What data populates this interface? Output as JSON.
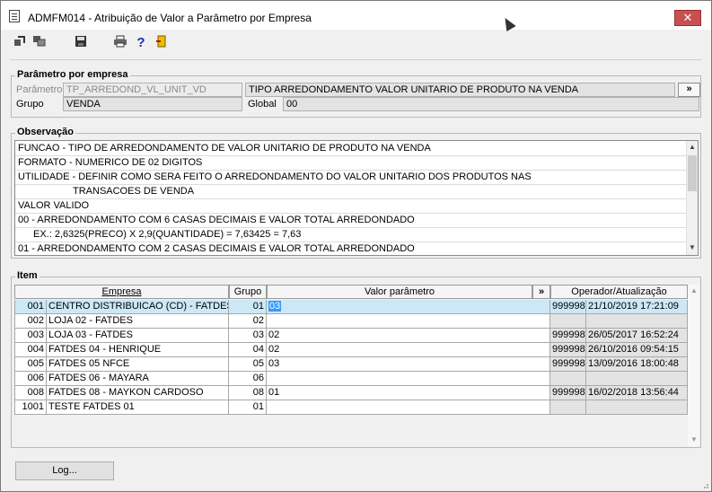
{
  "window": {
    "title": "ADMFM014 - Atribuição de Valor a Parâmetro por Empresa",
    "close_glyph": "✕"
  },
  "toolbar": {
    "icons": [
      "arrow-out-icon",
      "copy-icon",
      "save-icon",
      "print-icon",
      "help-icon",
      "exit-door-icon"
    ],
    "help_glyph": "?"
  },
  "parametro": {
    "section_title": "Parâmetro por empresa",
    "parametro_label": "Parâmetro",
    "parametro_value": "TP_ARREDOND_VL_UNIT_VD",
    "descricao_value": "TIPO ARREDONDAMENTO VALOR UNITARIO DE PRODUTO NA VENDA",
    "more_button": "»",
    "grupo_label": "Grupo",
    "grupo_value": "VENDA",
    "global_label": "Global",
    "global_value": "00"
  },
  "observacao": {
    "section_title": "Observação",
    "lines": [
      "FUNCAO - TIPO DE ARREDONDAMENTO DE VALOR UNITARIO DE PRODUTO NA VENDA",
      "FORMATO - NUMERICO DE 02 DIGITOS",
      "UTILIDADE - DEFINIR COMO SERA FEITO O ARREDONDAMENTO DO VALOR UNITARIO DOS PRODUTOS NAS",
      "TRANSACOES DE VENDA",
      "VALOR VALIDO",
      "00 - ARREDONDAMENTO COM 6 CASAS DECIMAIS E VALOR TOTAL ARREDONDADO",
      "EX.:   2,6325(PRECO) X 2,9(QUANTIDADE) = 7,63425 = 7,63",
      "01 - ARREDONDAMENTO COM 2 CASAS DECIMAIS E VALOR TOTAL ARREDONDADO"
    ]
  },
  "item": {
    "section_title": "Item",
    "columns": {
      "empresa": "Empresa",
      "grupo": "Grupo",
      "valor": "Valor parâmetro",
      "more": "»",
      "operador": "Operador/Atualização"
    },
    "rows": [
      {
        "cod": "001",
        "empresa": "CENTRO DISTRIBUICAO (CD) - FATDES",
        "grupo": "01",
        "valor": "03",
        "operador": "999998",
        "data": "21/10/2019 17:21:09"
      },
      {
        "cod": "002",
        "empresa": "LOJA 02 - FATDES",
        "grupo": "02",
        "valor": "",
        "operador": "",
        "data": ""
      },
      {
        "cod": "003",
        "empresa": "LOJA 03 - FATDES",
        "grupo": "03",
        "valor": "02",
        "operador": "999998",
        "data": "26/05/2017 16:52:24"
      },
      {
        "cod": "004",
        "empresa": "FATDES 04 - HENRIQUE",
        "grupo": "04",
        "valor": "02",
        "operador": "999998",
        "data": "26/10/2016 09:54:15"
      },
      {
        "cod": "005",
        "empresa": "FATDES 05 NFCE",
        "grupo": "05",
        "valor": "03",
        "operador": "999998",
        "data": "13/09/2016 18:00:48"
      },
      {
        "cod": "006",
        "empresa": "FATDES 06 - MAYARA",
        "grupo": "06",
        "valor": "",
        "operador": "",
        "data": ""
      },
      {
        "cod": "008",
        "empresa": "FATDES 08 - MAYKON CARDOSO",
        "grupo": "08",
        "valor": "01",
        "operador": "999998",
        "data": "16/02/2018 13:56:44"
      },
      {
        "cod": "1001",
        "empresa": "TESTE FATDES 01",
        "grupo": "01",
        "valor": "",
        "operador": "",
        "data": ""
      }
    ]
  },
  "footer": {
    "log_button": "Log..."
  }
}
